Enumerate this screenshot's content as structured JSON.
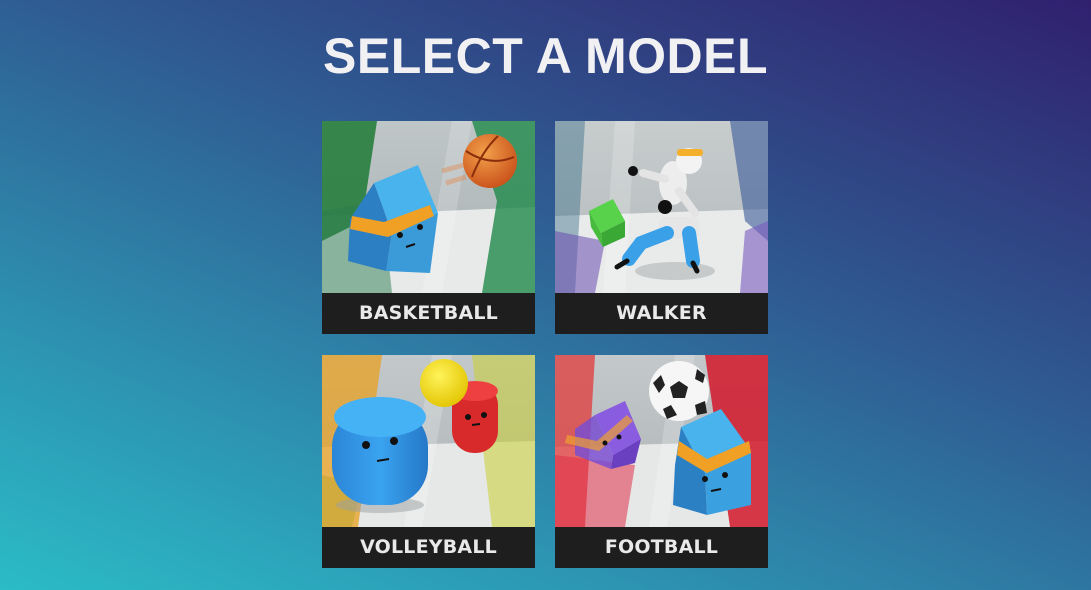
{
  "title": "SELECT A MODEL",
  "models": [
    {
      "label": "BASKETBALL",
      "icon": "basketball-scene-thumbnail"
    },
    {
      "label": "WALKER",
      "icon": "walker-scene-thumbnail"
    },
    {
      "label": "VOLLEYBALL",
      "icon": "volleyball-scene-thumbnail"
    },
    {
      "label": "FOOTBALL",
      "icon": "football-scene-thumbnail"
    }
  ]
}
